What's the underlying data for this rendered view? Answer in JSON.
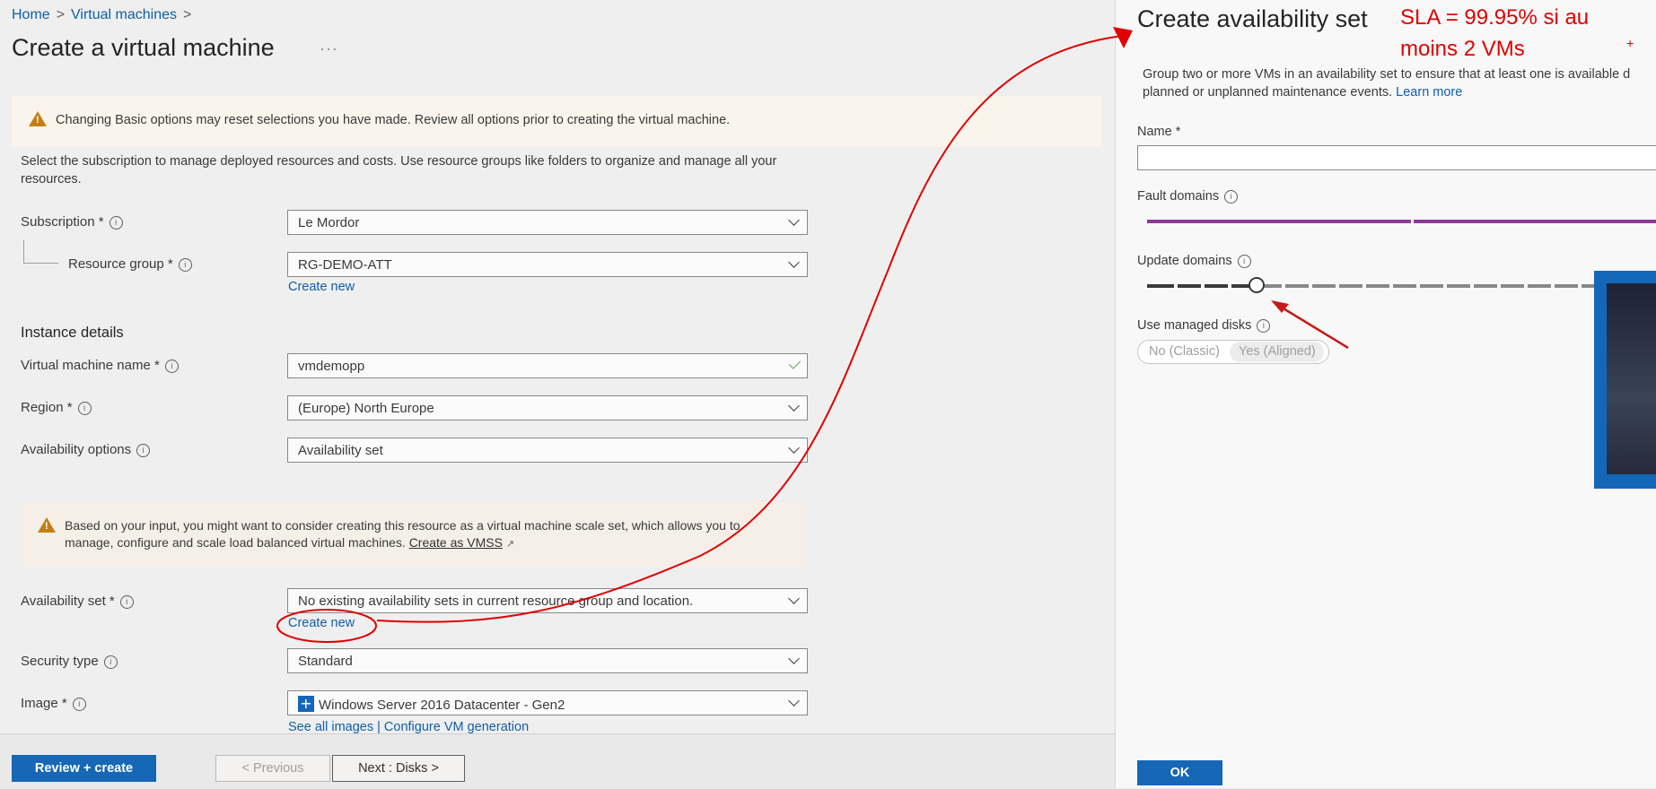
{
  "breadcrumb": {
    "home": "Home",
    "virtual_machines": "Virtual machines",
    "sep": ">"
  },
  "page_title": "Create a virtual machine",
  "more_label": "···",
  "warning_banner": "Changing Basic options may reset selections you have made. Review all options prior to creating the virtual machine.",
  "description": "Select the subscription to manage deployed resources and costs. Use resource groups like folders to organize and manage all your resources.",
  "fields": {
    "subscription": {
      "label": "Subscription *",
      "value": "Le Mordor"
    },
    "resource_group": {
      "label": "Resource group *",
      "value": "RG-DEMO-ATT",
      "link": "Create new"
    },
    "vm_name": {
      "label": "Virtual machine name *",
      "value": "vmdemopp"
    },
    "region": {
      "label": "Region *",
      "value": "(Europe) North Europe"
    },
    "availability_options": {
      "label": "Availability options",
      "value": "Availability set"
    },
    "availability_set": {
      "label": "Availability set *",
      "value": "No existing availability sets in current resource group and location.",
      "link": "Create new"
    },
    "security_type": {
      "label": "Security type",
      "value": "Standard"
    },
    "image": {
      "label": "Image *",
      "value": "Windows Server 2016 Datacenter - Gen2",
      "link": "See all images | Configure VM generation"
    }
  },
  "instance_details_heading": "Instance details",
  "vmss_warning": {
    "text": "Based on your input, you might want to consider creating this resource as a virtual machine scale set, which allows you to manage, configure and scale load balanced virtual machines.",
    "link": "Create as VMSS"
  },
  "footer": {
    "review_create": "Review + create",
    "previous": "< Previous",
    "next": "Next : Disks >"
  },
  "panel": {
    "title": "Create availability set",
    "description_line1": "Group two or more VMs in an availability set to ensure that at least one is available d",
    "description_line2": "planned or unplanned maintenance events.",
    "learn_more": "Learn more",
    "name_label": "Name *",
    "name_value": "",
    "fault_domains_label": "Fault domains",
    "fault_domains_value": 2,
    "update_domains_label": "Update domains",
    "update_domains_value": 5,
    "managed_disks_label": "Use managed disks",
    "managed_disks_options": [
      "No (Classic)",
      "Yes (Aligned)"
    ],
    "managed_disks_selected": "Yes (Aligned)",
    "ok_label": "OK"
  },
  "annotation": {
    "line1": "SLA = 99.95% si au",
    "line2": "moins 2 VMs",
    "plus": "+"
  },
  "colors": {
    "accent": "#1667b5",
    "link": "#0f5fa8",
    "warning": "#c47f14",
    "fault_slider": "#8b3a94",
    "annotation": "#e00000"
  },
  "icons": [
    "warning-icon",
    "info-icon",
    "chevron-down-icon",
    "check-icon",
    "windows-logo-icon",
    "external-link-icon"
  ]
}
